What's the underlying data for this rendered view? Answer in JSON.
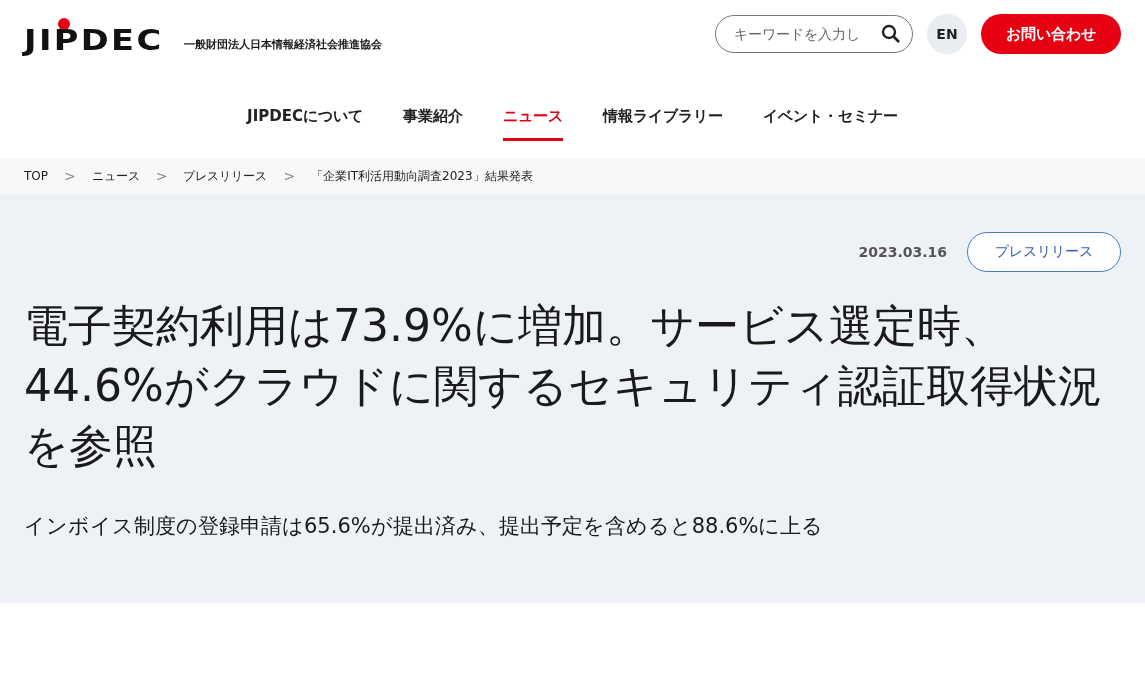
{
  "header": {
    "logo": "JIPDEC",
    "org_name": "一般財団法人日本情報経済社会推進協会",
    "search": {
      "placeholder": "キーワードを入力し"
    },
    "language_button": "EN",
    "contact_button": "お問い合わせ"
  },
  "nav": [
    {
      "label": "JIPDECについて",
      "selected": false
    },
    {
      "label": "事業紹介",
      "selected": false
    },
    {
      "label": "ニュース",
      "selected": true
    },
    {
      "label": "情報ライブラリー",
      "selected": false
    },
    {
      "label": "イベント・セミナー",
      "selected": false
    }
  ],
  "breadcrumb": {
    "separator": ">",
    "items": [
      "TOP",
      "ニュース",
      "プレスリリース",
      "「企業IT利活用動向調査2023」結果発表"
    ]
  },
  "article": {
    "date": "2023.03.16",
    "category": "プレスリリース",
    "title": "電子契約利用は73.9%に増加。サービス選定時、44.6%がクラウドに関するセキュリティ認証取得状況を参照",
    "subtitle": "インボイス制度の登録申請は65.6%が提出済み、提出予定を含めると88.6%に上る"
  }
}
